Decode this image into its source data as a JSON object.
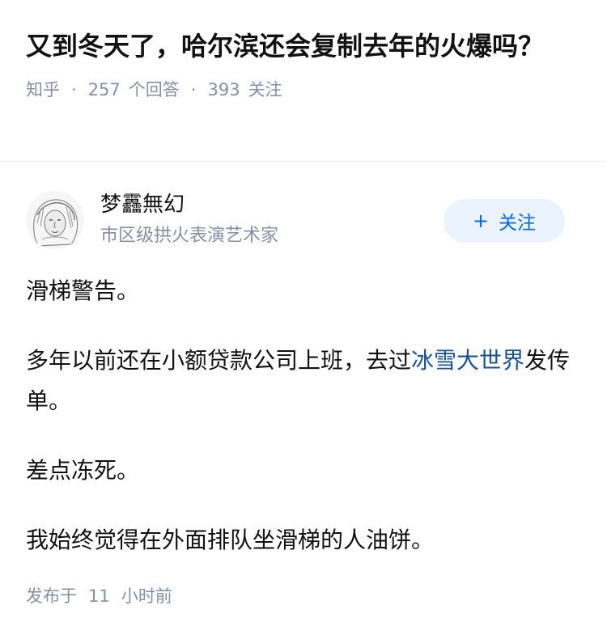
{
  "question": {
    "title": "又到冬天了，哈尔滨还会复制去年的火爆吗？",
    "source": "知乎",
    "separator": "·",
    "answer_count": "257",
    "answer_label": "个回答",
    "follower_count": "393",
    "follower_label": "关注"
  },
  "author": {
    "name": "梦靐無幻",
    "headline": "市区级拱火表演艺术家",
    "avatar_icon": "sketch-portrait-avatar",
    "follow_plus": "+",
    "follow_label": "关注"
  },
  "answer": {
    "paragraphs": {
      "p1": "滑梯警告。",
      "p2_before": "多年以前还在小额贷款公司上班，去过",
      "p2_link": "冰雪大世界",
      "p2_after": "发传单。",
      "p3": "差点冻死。",
      "p4": "我始终觉得在外面排队坐滑梯的人油饼。"
    },
    "link_color": "#175199"
  },
  "publish": {
    "label": "发布于",
    "time_value": "11",
    "time_unit": "小时前"
  },
  "colors": {
    "text_primary": "#121212",
    "text_secondary": "#8590a6",
    "follow_bg": "#ebf3ff",
    "follow_text": "#0066ff"
  }
}
